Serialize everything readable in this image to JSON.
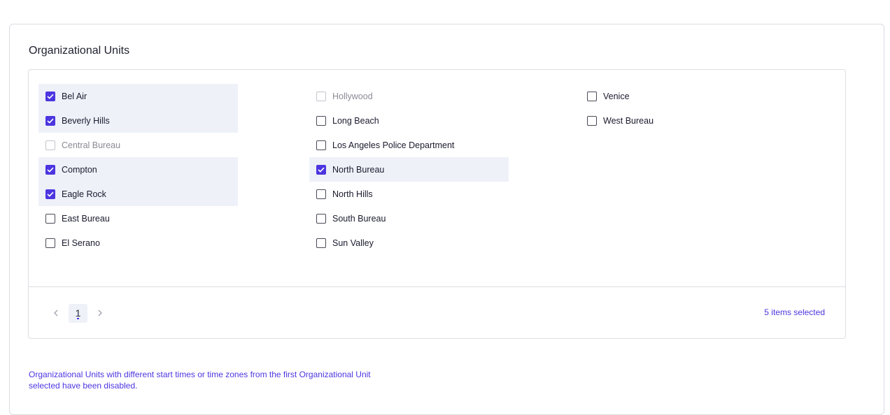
{
  "section": {
    "title": "Organizational Units"
  },
  "columns": [
    [
      {
        "label": "Bel Air",
        "checked": true,
        "disabled": false
      },
      {
        "label": "Beverly Hills",
        "checked": true,
        "disabled": false
      },
      {
        "label": "Central Bureau",
        "checked": false,
        "disabled": true
      },
      {
        "label": "Compton",
        "checked": true,
        "disabled": false
      },
      {
        "label": "Eagle Rock",
        "checked": true,
        "disabled": false
      },
      {
        "label": "East Bureau",
        "checked": false,
        "disabled": false
      },
      {
        "label": "El Serano",
        "checked": false,
        "disabled": false
      }
    ],
    [
      {
        "label": "Hollywood",
        "checked": false,
        "disabled": true
      },
      {
        "label": "Long Beach",
        "checked": false,
        "disabled": false
      },
      {
        "label": "Los Angeles Police Department",
        "checked": false,
        "disabled": false
      },
      {
        "label": "North Bureau",
        "checked": true,
        "disabled": false
      },
      {
        "label": "North Hills",
        "checked": false,
        "disabled": false
      },
      {
        "label": "South Bureau",
        "checked": false,
        "disabled": false
      },
      {
        "label": "Sun Valley",
        "checked": false,
        "disabled": false
      }
    ],
    [
      {
        "label": "Venice",
        "checked": false,
        "disabled": false
      },
      {
        "label": "West Bureau",
        "checked": false,
        "disabled": false
      }
    ]
  ],
  "pagination": {
    "prev_icon": "chevron-left-icon",
    "current_page": "1",
    "next_icon": "chevron-right-icon"
  },
  "selection": {
    "summary": "5 items selected"
  },
  "notice": {
    "text": "Organizational Units with different start times or time zones from the first Organizational Unit selected have been disabled."
  },
  "colors": {
    "accent": "#4b36e0",
    "selected_row_bg": "#eef1f8",
    "border": "#dcdce3"
  }
}
